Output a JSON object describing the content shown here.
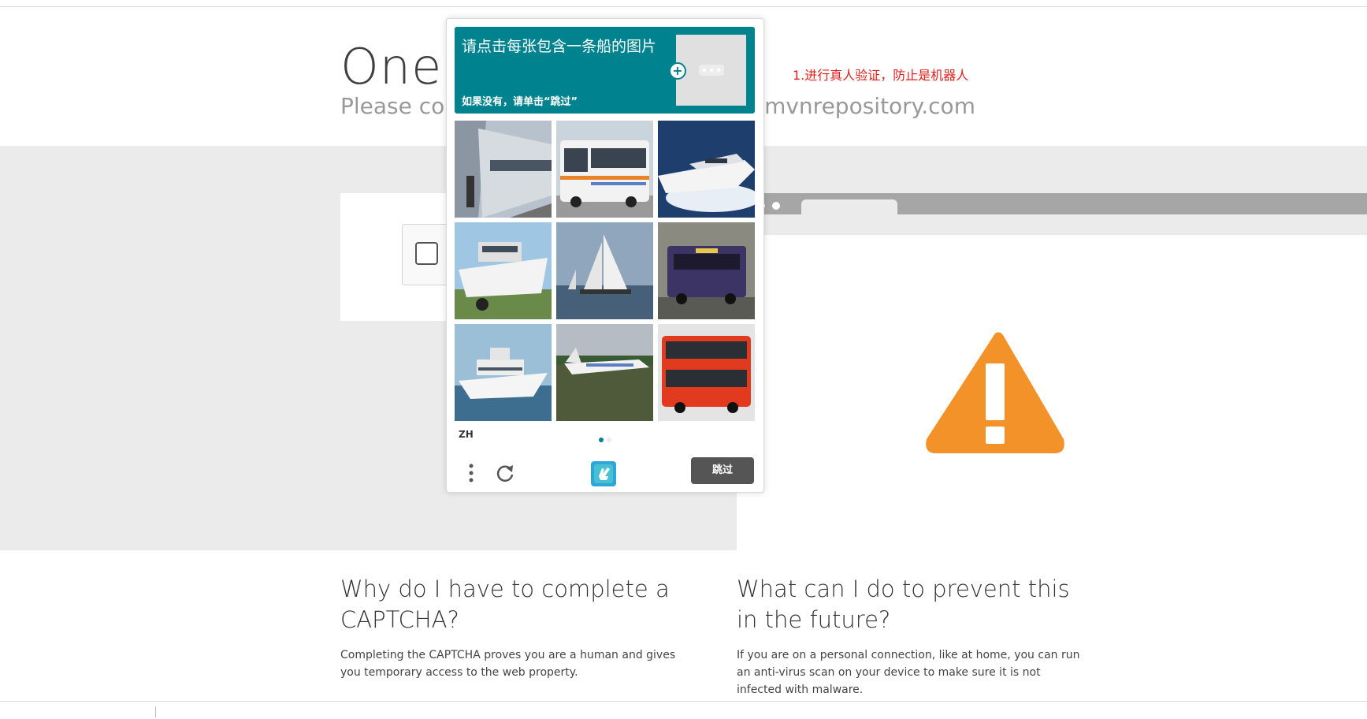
{
  "page": {
    "title": "One m",
    "subtitle_left": "Please com",
    "subtitle_right": "ss mvnrepository.com",
    "annotation": "1.进行真人验证，防止是机器人",
    "faq": [
      {
        "question": "Why do I have to complete a CAPTCHA?",
        "answer": "Completing the CAPTCHA proves you are a human and gives you temporary access to the web property."
      },
      {
        "question": "What can I do to prevent this in the future?",
        "answer": "If you are on a personal connection, like at home, you can run an anti-virus scan on your device to make sure it is not infected with malware."
      }
    ]
  },
  "captcha": {
    "instruction": "请点击每张包含一条船的图片",
    "hint": "如果没有，请单击“跳过”",
    "language": "ZH",
    "skip_label": "跳过",
    "brand_color": "#00838f",
    "tiles": [
      {
        "subject": "train-platform"
      },
      {
        "subject": "city-bus"
      },
      {
        "subject": "speedboat"
      },
      {
        "subject": "boat-on-trailer"
      },
      {
        "subject": "sailboats"
      },
      {
        "subject": "purple-bus"
      },
      {
        "subject": "yacht"
      },
      {
        "subject": "airplane"
      },
      {
        "subject": "double-decker-bus"
      }
    ]
  },
  "colors": {
    "warning": "#f39229",
    "annotation": "#e02020",
    "skip_button": "#555555"
  }
}
